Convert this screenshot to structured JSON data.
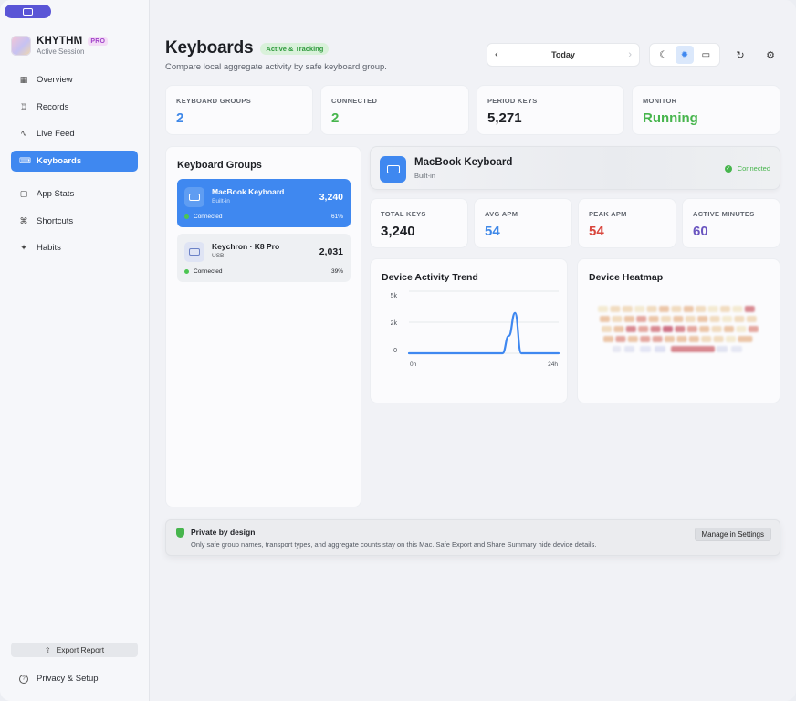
{
  "sidebar": {
    "brand": {
      "name": "KHYTHM",
      "badge": "PRO",
      "subtitle": "Active Session"
    },
    "nav_primary": [
      {
        "label": "Overview",
        "icon": "grid-icon"
      },
      {
        "label": "Records",
        "icon": "trophy-icon"
      },
      {
        "label": "Live Feed",
        "icon": "pulse-icon"
      },
      {
        "label": "Keyboards",
        "icon": "keyboard-icon",
        "active": true
      }
    ],
    "nav_secondary": [
      {
        "label": "App Stats",
        "icon": "app-square-icon"
      },
      {
        "label": "Shortcuts",
        "icon": "command-icon"
      },
      {
        "label": "Habits",
        "icon": "sparkle-icon"
      }
    ],
    "export_label": "Export Report",
    "privacy_label": "Privacy & Setup"
  },
  "header": {
    "title": "Keyboards",
    "status_badge": "Active & Tracking",
    "subtitle": "Compare local aggregate activity by safe keyboard group.",
    "date_label": "Today"
  },
  "stats": [
    {
      "label": "KEYBOARD GROUPS",
      "value": "2",
      "color": "#3f88e8"
    },
    {
      "label": "CONNECTED",
      "value": "2",
      "color": "#47b54d"
    },
    {
      "label": "PERIOD KEYS",
      "value": "5,271",
      "color": "#1d1f24"
    },
    {
      "label": "MONITOR",
      "value": "Running",
      "color": "#47b54d"
    }
  ],
  "groups": {
    "title": "Keyboard Groups",
    "items": [
      {
        "name": "MacBook Keyboard",
        "type": "Built-in",
        "count": "3,240",
        "status": "Connected",
        "percent": "61%",
        "active": true
      },
      {
        "name": "Keychron · K8 Pro",
        "type": "USB",
        "count": "2,031",
        "status": "Connected",
        "percent": "39%",
        "active": false
      }
    ]
  },
  "device": {
    "name": "MacBook Keyboard",
    "type": "Built-in",
    "status": "Connected",
    "metrics": [
      {
        "label": "TOTAL KEYS",
        "value": "3,240",
        "color": "#1d1f24"
      },
      {
        "label": "AVG APM",
        "value": "54",
        "color": "#3f88e8"
      },
      {
        "label": "PEAK APM",
        "value": "54",
        "color": "#d9473e"
      },
      {
        "label": "ACTIVE MINUTES",
        "value": "60",
        "color": "#6a55c0"
      }
    ]
  },
  "trend": {
    "title": "Device Activity Trend",
    "chart_data": {
      "type": "line",
      "title": "Device Activity Trend",
      "xlabel": "",
      "ylabel": "",
      "x_tick_labels": [
        "0h",
        "24h"
      ],
      "y_tick_labels": [
        "5k",
        "2k",
        "0"
      ],
      "x": [
        0,
        15,
        16,
        17,
        18,
        24
      ],
      "values": [
        0,
        0,
        1400,
        3240,
        0,
        0
      ],
      "xlim": [
        0,
        24
      ],
      "ylim": [
        0,
        5000
      ],
      "grid": true,
      "line_color": "#3f88f0"
    }
  },
  "heatmap": {
    "title": "Device Heatmap",
    "legend": []
  },
  "privacy": {
    "title": "Private by design",
    "text": "Only safe group names, transport types, and aggregate counts stay on this Mac. Safe Export and Share Summary hide device details.",
    "button": "Manage in Settings"
  }
}
